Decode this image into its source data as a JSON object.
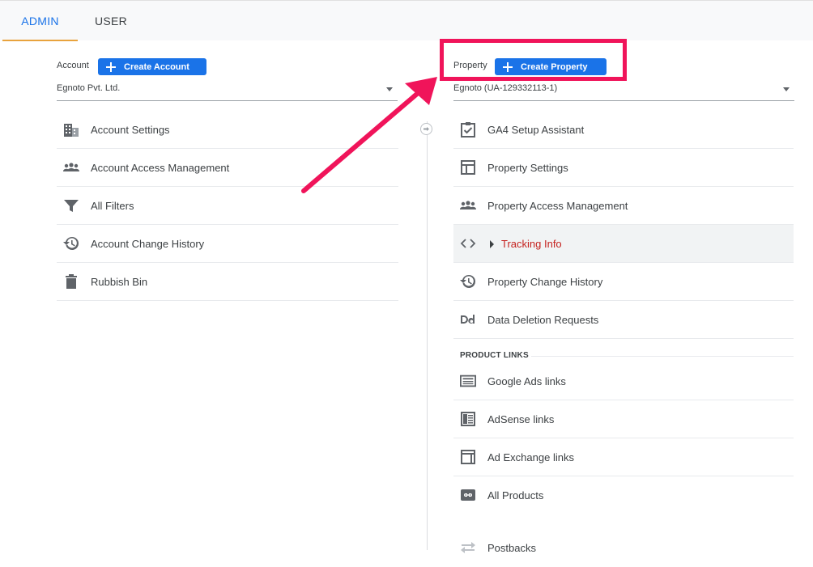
{
  "tabs": {
    "admin": "ADMIN",
    "user": "USER"
  },
  "account": {
    "label": "Account",
    "create_button": "Create Account",
    "selected": "Egnoto Pvt. Ltd.",
    "items": [
      {
        "label": "Account Settings",
        "icon": "building-icon"
      },
      {
        "label": "Account Access Management",
        "icon": "people-icon"
      },
      {
        "label": "All Filters",
        "icon": "filter-icon"
      },
      {
        "label": "Account Change History",
        "icon": "history-icon"
      },
      {
        "label": "Rubbish Bin",
        "icon": "trash-icon"
      }
    ]
  },
  "property": {
    "label": "Property",
    "create_button": "Create Property",
    "selected": "Egnoto (UA-129332113-1)",
    "items": [
      {
        "label": "GA4 Setup Assistant",
        "icon": "clipboard-check-icon"
      },
      {
        "label": "Property Settings",
        "icon": "layout-icon"
      },
      {
        "label": "Property Access Management",
        "icon": "people-icon"
      },
      {
        "label": "Tracking Info",
        "icon": "code-icon"
      },
      {
        "label": "Property Change History",
        "icon": "history-icon"
      },
      {
        "label": "Data Deletion Requests",
        "icon": "dd-icon"
      }
    ],
    "product_links_title": "PRODUCT LINKS",
    "product_links": [
      {
        "label": "Google Ads links",
        "icon": "ads-icon"
      },
      {
        "label": "AdSense links",
        "icon": "adsense-icon"
      },
      {
        "label": "Ad Exchange links",
        "icon": "adexchange-icon"
      },
      {
        "label": "All Products",
        "icon": "link-icon"
      },
      {
        "label": "Postbacks",
        "icon": "postbacks-icon"
      }
    ]
  },
  "colors": {
    "accent": "#1a73e8",
    "annotation": "#f0145a",
    "tracking": "#c5221f"
  }
}
